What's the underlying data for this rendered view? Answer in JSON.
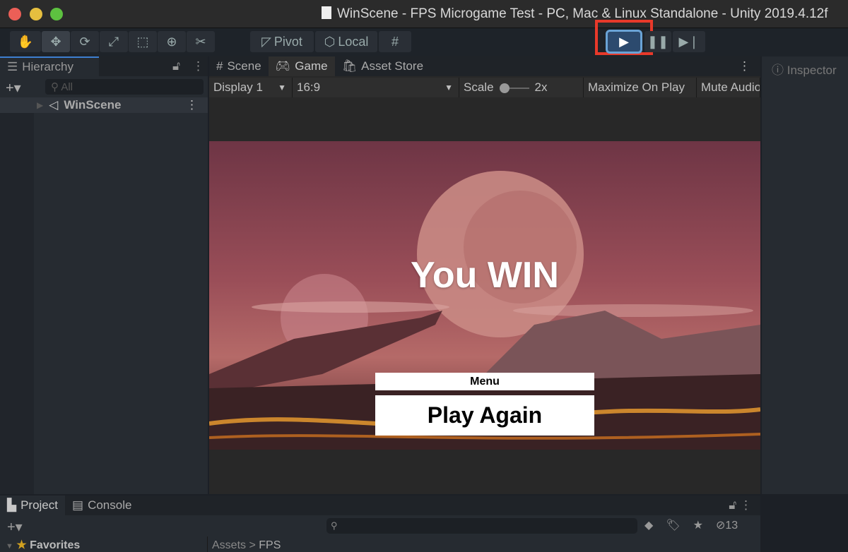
{
  "window": {
    "title": "WinScene - FPS Microgame Test - PC, Mac & Linux Standalone - Unity 2019.4.12f"
  },
  "toolbar": {
    "pivot": "Pivot",
    "local": "Local",
    "tools": [
      "hand-icon",
      "move-icon",
      "rotate-icon",
      "scale-icon",
      "rect-icon",
      "transform-icon",
      "custom-tool-icon"
    ]
  },
  "hierarchy": {
    "title": "Hierarchy",
    "search_placeholder": "All",
    "items": [
      {
        "label": "WinScene"
      }
    ]
  },
  "main_tabs": [
    {
      "label": "Scene"
    },
    {
      "label": "Game",
      "active": true
    },
    {
      "label": "Asset Store"
    }
  ],
  "game_toolbar": {
    "display": "Display 1",
    "aspect": "16:9",
    "scale_label": "Scale",
    "scale_value": "2x",
    "maximize": "Maximize On Play",
    "mute": "Mute Audio"
  },
  "game": {
    "title": "You WIN",
    "menu_button": "Menu",
    "play_again_button": "Play Again"
  },
  "inspector": {
    "title": "Inspector"
  },
  "bottom": {
    "tabs": [
      {
        "label": "Project",
        "active": true
      },
      {
        "label": "Console"
      }
    ],
    "hidden_count": "13",
    "favorites": "Favorites",
    "breadcrumb": [
      "Assets",
      "FPS"
    ]
  },
  "colors": {
    "highlight": "#e8392a",
    "play_active": "#2c4a6e"
  }
}
